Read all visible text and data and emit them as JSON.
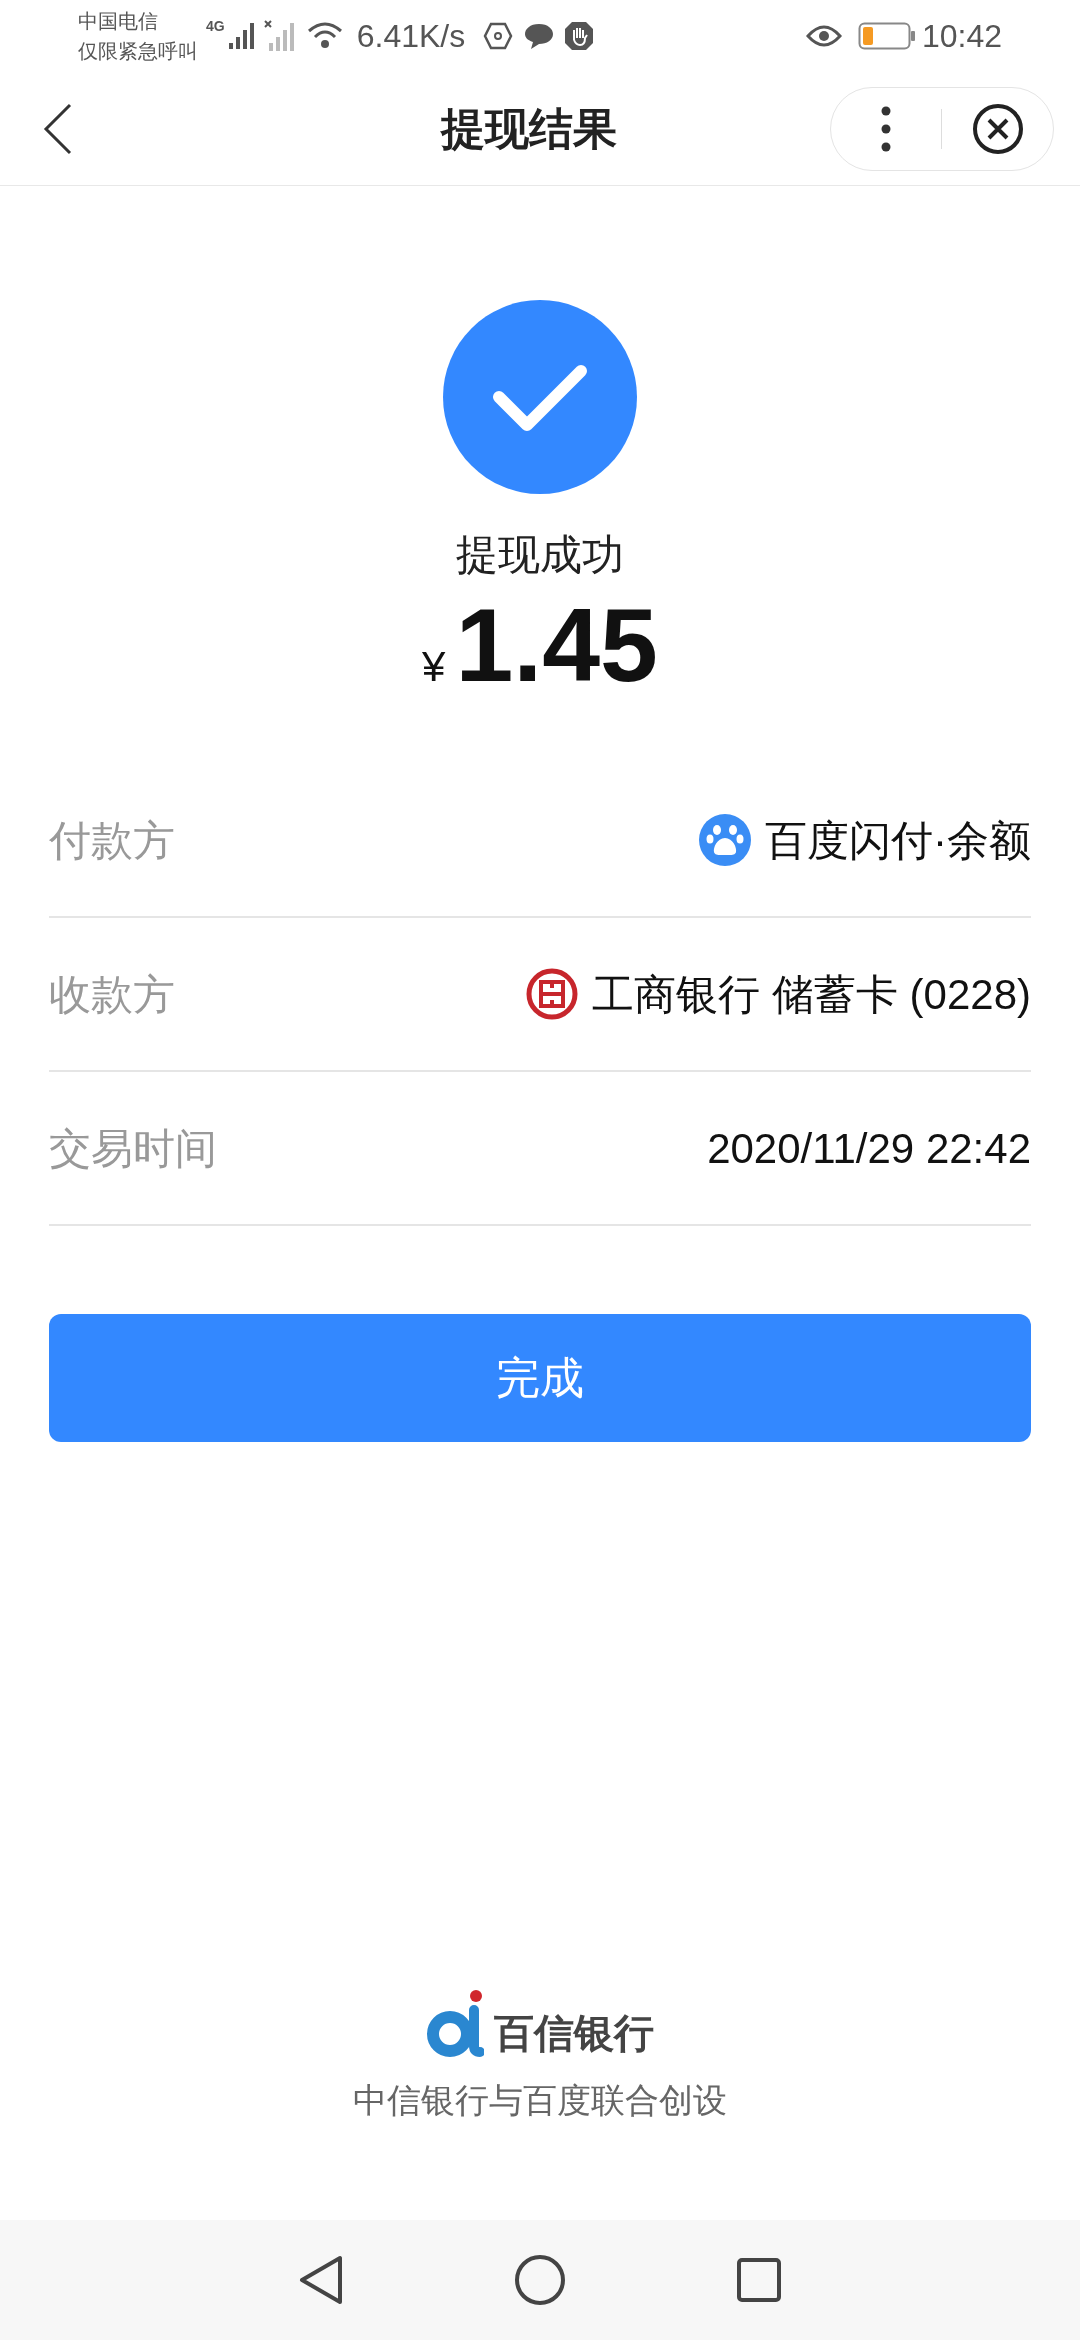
{
  "status_bar": {
    "carrier_lines": [
      "中国电信",
      "仅限紧急呼叫"
    ],
    "network": "4G",
    "speed": "6.41K/s",
    "time": "10:42"
  },
  "header": {
    "title": "提现结果"
  },
  "result": {
    "status": "提现成功",
    "currency": "¥",
    "amount": "1.45"
  },
  "details": [
    {
      "kind": "wallet",
      "label": "付款方",
      "value": "百度闪付·余额"
    },
    {
      "kind": "bank",
      "label": "收款方",
      "value": "工商银行 储蓄卡 (0228)"
    },
    {
      "kind": "plain",
      "label": "交易时间",
      "value": "2020/11/29 22:42"
    }
  ],
  "button": {
    "label": "完成"
  },
  "footer": {
    "brand": "百信银行",
    "tagline": "中信银行与百度联合创设"
  }
}
